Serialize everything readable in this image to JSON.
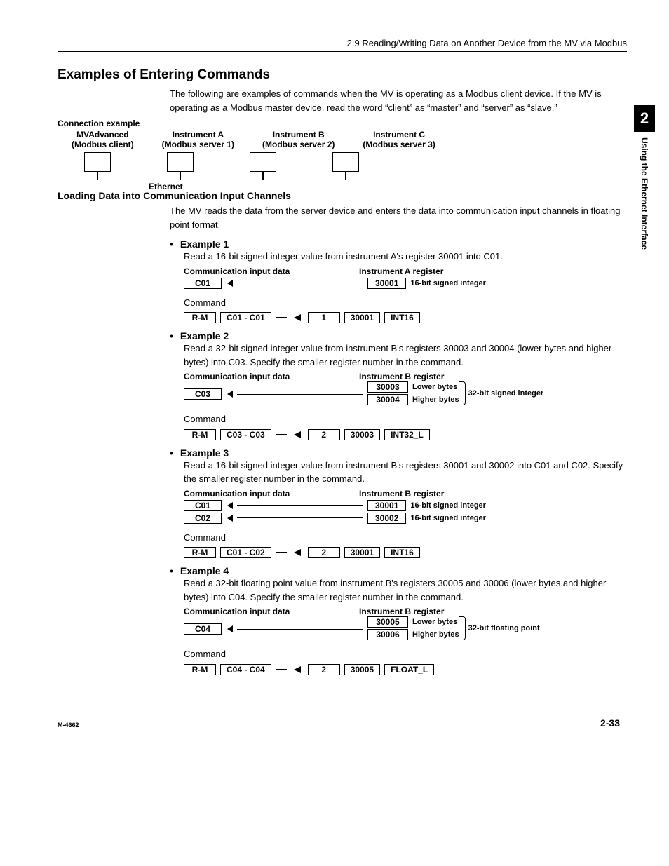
{
  "header": {
    "running": "2.9  Reading/Writing Data on Another Device from the MV via Modbus"
  },
  "sidetab": {
    "num": "2",
    "text": "Using the Ethernet Interface"
  },
  "h1": "Examples of Entering Commands",
  "intro": "The following are examples of commands when the MV is operating as a Modbus client device. If the MV is operating as a Modbus master device, read the word “client” as “master” and “server” as “slave.”",
  "conn": {
    "title": "Connection example",
    "devices": [
      {
        "name": "MVAdvanced",
        "role": "(Modbus client)"
      },
      {
        "name": "Instrument A",
        "role": "(Modbus server 1)"
      },
      {
        "name": "Instrument B",
        "role": "(Modbus server 2)"
      },
      {
        "name": "Instrument C",
        "role": "(Modbus server 3)"
      }
    ],
    "bus": "Ethernet"
  },
  "loading": {
    "title": "Loading Data into Communication Input Channels",
    "desc": "The MV reads the data from the server device and enters the data into communication input channels in floating point format."
  },
  "ex1": {
    "title": "Example 1",
    "desc": "Read a 16-bit signed integer value from instrument A's register 30001 into C01.",
    "io_left": "Communication input data",
    "io_right": "Instrument A register",
    "ch": "C01",
    "reg": "30001",
    "regtype": "16-bit signed integer",
    "cmd_label": "Command",
    "cmd": {
      "a": "R-M",
      "b": "C01 - C01",
      "c": "1",
      "d": "30001",
      "e": "INT16"
    }
  },
  "ex2": {
    "title": "Example 2",
    "desc": "Read a 32-bit signed integer value from instrument B's registers 30003 and 30004 (lower bytes and higher bytes) into C03. Specify the smaller register number in the command.",
    "io_left": "Communication input data",
    "io_right": "Instrument B register",
    "ch": "C03",
    "reg1": "30003",
    "reg1d": "Lower bytes",
    "reg2": "30004",
    "reg2d": "Higher bytes",
    "regtype": "32-bit signed integer",
    "cmd_label": "Command",
    "cmd": {
      "a": "R-M",
      "b": "C03 - C03",
      "c": "2",
      "d": "30003",
      "e": "INT32_L"
    }
  },
  "ex3": {
    "title": "Example 3",
    "desc": "Read a 16-bit signed integer value from instrument B's registers 30001 and 30002 into C01 and C02. Specify the smaller register number in the command.",
    "io_left": "Communication input data",
    "io_right": "Instrument B register",
    "ch1": "C01",
    "reg1": "30001",
    "reg1d": "16-bit signed integer",
    "ch2": "C02",
    "reg2": "30002",
    "reg2d": "16-bit signed integer",
    "cmd_label": "Command",
    "cmd": {
      "a": "R-M",
      "b": "C01 - C02",
      "c": "2",
      "d": "30001",
      "e": "INT16"
    }
  },
  "ex4": {
    "title": "Example 4",
    "desc": "Read a 32-bit floating point value from instrument B's registers 30005 and 30006 (lower bytes and higher bytes) into C04. Specify the smaller register number in the command.",
    "io_left": "Communication input data",
    "io_right": "Instrument B register",
    "ch": "C04",
    "reg1": "30005",
    "reg1d": "Lower bytes",
    "reg2": "30006",
    "reg2d": "Higher bytes",
    "regtype": "32-bit floating point",
    "cmd_label": "Command",
    "cmd": {
      "a": "R-M",
      "b": "C04 - C04",
      "c": "2",
      "d": "30005",
      "e": "FLOAT_L"
    }
  },
  "footer": {
    "left": "M-4662",
    "right": "2-33"
  }
}
